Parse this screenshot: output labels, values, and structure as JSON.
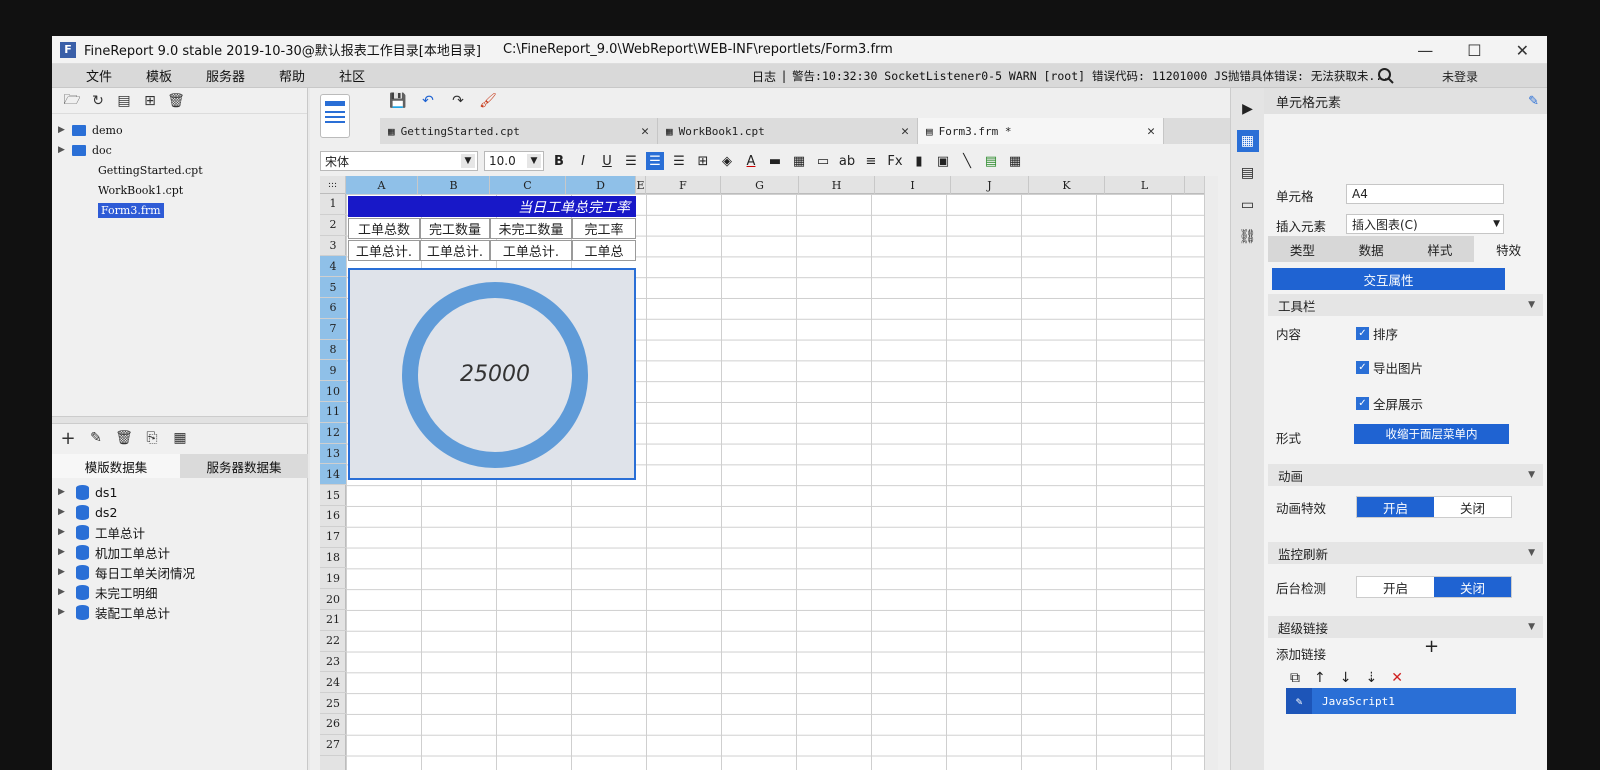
{
  "window": {
    "title": "FineReport 9.0 stable 2019-10-30@默认报表工作目录[本地目录]",
    "path": "C:\\FineReport_9.0\\WebReport\\WEB-INF\\reportlets/Form3.frm",
    "controls": [
      "—",
      "☐",
      "✕"
    ]
  },
  "menu": {
    "items": [
      "文件",
      "模板",
      "服务器",
      "帮助",
      "社区"
    ],
    "log_label": "日志",
    "log_message": "警告:10:32:30 SocketListener0-5 WARN [root] 错误代码: 11201000 JS抛错具体错误: 无法获取未...",
    "login": "未登录"
  },
  "file_tree": [
    {
      "name": "demo",
      "type": "folder"
    },
    {
      "name": "doc",
      "type": "folder"
    },
    {
      "name": "GettingStarted.cpt",
      "type": "file"
    },
    {
      "name": "WorkBook1.cpt",
      "type": "file"
    },
    {
      "name": "Form3.frm",
      "type": "file",
      "selected": true
    }
  ],
  "datasets": {
    "tabs": [
      "模版数据集",
      "服务器数据集"
    ],
    "items": [
      "ds1",
      "ds2",
      "工单总计",
      "机加工单总计",
      "每日工单关闭情况",
      "未完工明细",
      "装配工单总计"
    ]
  },
  "tabs": [
    {
      "label": "GettingStarted.cpt"
    },
    {
      "label": "WorkBook1.cpt"
    },
    {
      "label": "Form3.frm *"
    }
  ],
  "format": {
    "font": "宋体",
    "size": "10.0",
    "bold": "B",
    "italic": "I",
    "underline": "U"
  },
  "grid": {
    "columns": [
      "A",
      "B",
      "C",
      "D",
      "E",
      "F",
      "G",
      "H",
      "I",
      "J",
      "K",
      "L"
    ],
    "rows": [
      "1",
      "2",
      "3",
      "4",
      "5",
      "6",
      "7",
      "8",
      "9",
      "10",
      "11",
      "12",
      "13",
      "14",
      "15",
      "16",
      "17",
      "18",
      "19",
      "20",
      "21",
      "22",
      "23",
      "24",
      "25",
      "26",
      "27"
    ],
    "title": "当日工单总完工率",
    "headers": [
      "工单总数",
      "完工数量",
      "未完工数量",
      "完工率"
    ],
    "row3": [
      "工单总计.",
      "工单总计.",
      "工单总计.",
      "工单总"
    ],
    "chart_value": "25000"
  },
  "right_panel": {
    "title": "单元格元素",
    "cell_label": "单元格",
    "cell_value": "A4",
    "insert_label": "插入元素",
    "insert_value": "插入图表(C)",
    "tabs": [
      "类型",
      "数据",
      "样式",
      "特效"
    ],
    "interaction": "交互属性",
    "toolbar_section": "工具栏",
    "content_label": "内容",
    "options": [
      "排序",
      "导出图片",
      "全屏展示"
    ],
    "form_label": "形式",
    "form_value": "收缩于面层菜单内",
    "animation_section": "动画",
    "animation_label": "动画特效",
    "on": "开启",
    "off": "关闭",
    "monitor_section": "监控刷新",
    "backend_label": "后台检测",
    "hyperlink_section": "超级链接",
    "add_link": "添加链接",
    "link_item": "JavaScript1"
  }
}
